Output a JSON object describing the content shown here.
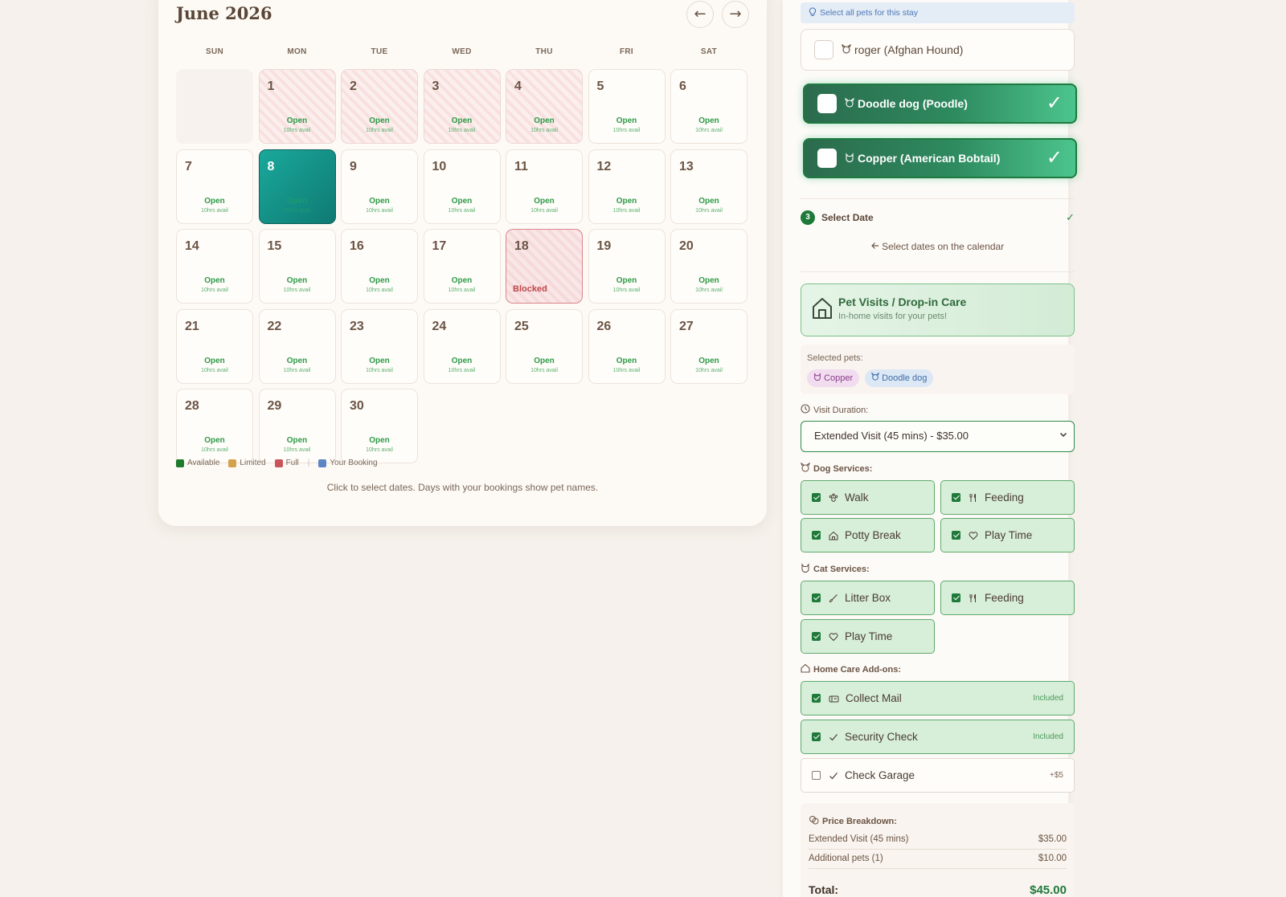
{
  "calendar": {
    "title": "June 2026",
    "prev_icon": "←",
    "next_icon": "→",
    "weekdays": [
      "SUN",
      "MON",
      "TUE",
      "WED",
      "THU",
      "FRI",
      "SAT"
    ],
    "leading_blank_days": 1,
    "days": [
      {
        "n": "1",
        "state": "limited",
        "status": "Open",
        "avail": "10hrs avail"
      },
      {
        "n": "2",
        "state": "limited",
        "status": "Open",
        "avail": "10hrs avail"
      },
      {
        "n": "3",
        "state": "limited",
        "status": "Open",
        "avail": "10hrs avail"
      },
      {
        "n": "4",
        "state": "limited",
        "status": "Open",
        "avail": "10hrs avail"
      },
      {
        "n": "5",
        "state": "open",
        "status": "Open",
        "avail": "10hrs avail"
      },
      {
        "n": "6",
        "state": "open",
        "status": "Open",
        "avail": "10hrs avail"
      },
      {
        "n": "7",
        "state": "open",
        "status": "Open",
        "avail": "10hrs avail"
      },
      {
        "n": "8",
        "state": "selected",
        "status": "Open",
        "avail": "10hrs avail"
      },
      {
        "n": "9",
        "state": "open",
        "status": "Open",
        "avail": "10hrs avail"
      },
      {
        "n": "10",
        "state": "open",
        "status": "Open",
        "avail": "10hrs avail"
      },
      {
        "n": "11",
        "state": "open",
        "status": "Open",
        "avail": "10hrs avail"
      },
      {
        "n": "12",
        "state": "open",
        "status": "Open",
        "avail": "10hrs avail"
      },
      {
        "n": "13",
        "state": "open",
        "status": "Open",
        "avail": "10hrs avail"
      },
      {
        "n": "14",
        "state": "open",
        "status": "Open",
        "avail": "10hrs avail"
      },
      {
        "n": "15",
        "state": "open",
        "status": "Open",
        "avail": "10hrs avail"
      },
      {
        "n": "16",
        "state": "open",
        "status": "Open",
        "avail": "10hrs avail"
      },
      {
        "n": "17",
        "state": "open",
        "status": "Open",
        "avail": "10hrs avail"
      },
      {
        "n": "18",
        "state": "blocked",
        "status": "Blocked",
        "avail": ""
      },
      {
        "n": "19",
        "state": "open",
        "status": "Open",
        "avail": "10hrs avail"
      },
      {
        "n": "20",
        "state": "open",
        "status": "Open",
        "avail": "10hrs avail"
      },
      {
        "n": "21",
        "state": "open",
        "status": "Open",
        "avail": "10hrs avail"
      },
      {
        "n": "22",
        "state": "open",
        "status": "Open",
        "avail": "10hrs avail"
      },
      {
        "n": "23",
        "state": "open",
        "status": "Open",
        "avail": "10hrs avail"
      },
      {
        "n": "24",
        "state": "open",
        "status": "Open",
        "avail": "10hrs avail"
      },
      {
        "n": "25",
        "state": "open",
        "status": "Open",
        "avail": "10hrs avail"
      },
      {
        "n": "26",
        "state": "open",
        "status": "Open",
        "avail": "10hrs avail"
      },
      {
        "n": "27",
        "state": "open",
        "status": "Open",
        "avail": "10hrs avail"
      },
      {
        "n": "28",
        "state": "open",
        "status": "Open",
        "avail": "10hrs avail"
      },
      {
        "n": "29",
        "state": "open",
        "status": "Open",
        "avail": "10hrs avail"
      },
      {
        "n": "30",
        "state": "open",
        "status": "Open",
        "avail": "10hrs avail"
      }
    ],
    "legend": [
      {
        "label": "Available",
        "color": "#1f7a2e"
      },
      {
        "label": "Limited",
        "color": "#d4a24c"
      },
      {
        "label": "Full",
        "color": "#c9555b"
      },
      {
        "label": "Your Booking",
        "color": "#5b86c4"
      }
    ],
    "legend_separator": "|",
    "hint": "Click to select dates. Days with your bookings show pet names."
  },
  "panel": {
    "hint": "Select all pets for this stay",
    "pets": [
      {
        "label": "roger (Afghan Hound)",
        "selected": false,
        "icon": "dog-icon"
      },
      {
        "label": "Doodle dog (Poodle)",
        "selected": true,
        "icon": "dog-icon"
      },
      {
        "label": "Copper (American Bobtail)",
        "selected": true,
        "icon": "cat-icon"
      }
    ],
    "pet_selected_mark": "✓",
    "step": {
      "number": "3",
      "label": "Select Date",
      "check": "✓"
    },
    "calendar_link": "Select dates on the calendar",
    "service": {
      "title": "Pet Visits / Drop-in Care",
      "subtitle": "In-home visits for your pets!"
    },
    "selected_pets_label": "Selected pets:",
    "selected_pets": [
      "Copper",
      "Doodle dog"
    ],
    "visit_duration_label": "Visit Duration:",
    "visit_duration_value": "Extended Visit (45 mins) - $35.00",
    "dog_services_label": "Dog Services:",
    "dog_services": [
      "Walk",
      "Feeding",
      "Potty Break",
      "Play Time"
    ],
    "cat_services_label": "Cat Services:",
    "cat_services": [
      "Litter Box",
      "Feeding",
      "Play Time"
    ],
    "home_addons_label": "Home Care Add-ons:",
    "home_addons": [
      {
        "label": "Collect Mail",
        "price": "Included",
        "checked": true
      },
      {
        "label": "Security Check",
        "price": "Included",
        "checked": true
      },
      {
        "label": "Check Garage",
        "price": "+$5",
        "checked": false
      }
    ],
    "price": {
      "title": "Price Breakdown:",
      "rows": [
        {
          "label": "Extended Visit (45 mins)",
          "value": "$35.00"
        },
        {
          "label": "Additional pets (1)",
          "value": "$10.00"
        }
      ],
      "total_label": "Total:",
      "total_value": "$45.00"
    },
    "colors": {
      "accent": "#1f7a3a",
      "selected_day": "#138d83"
    }
  }
}
